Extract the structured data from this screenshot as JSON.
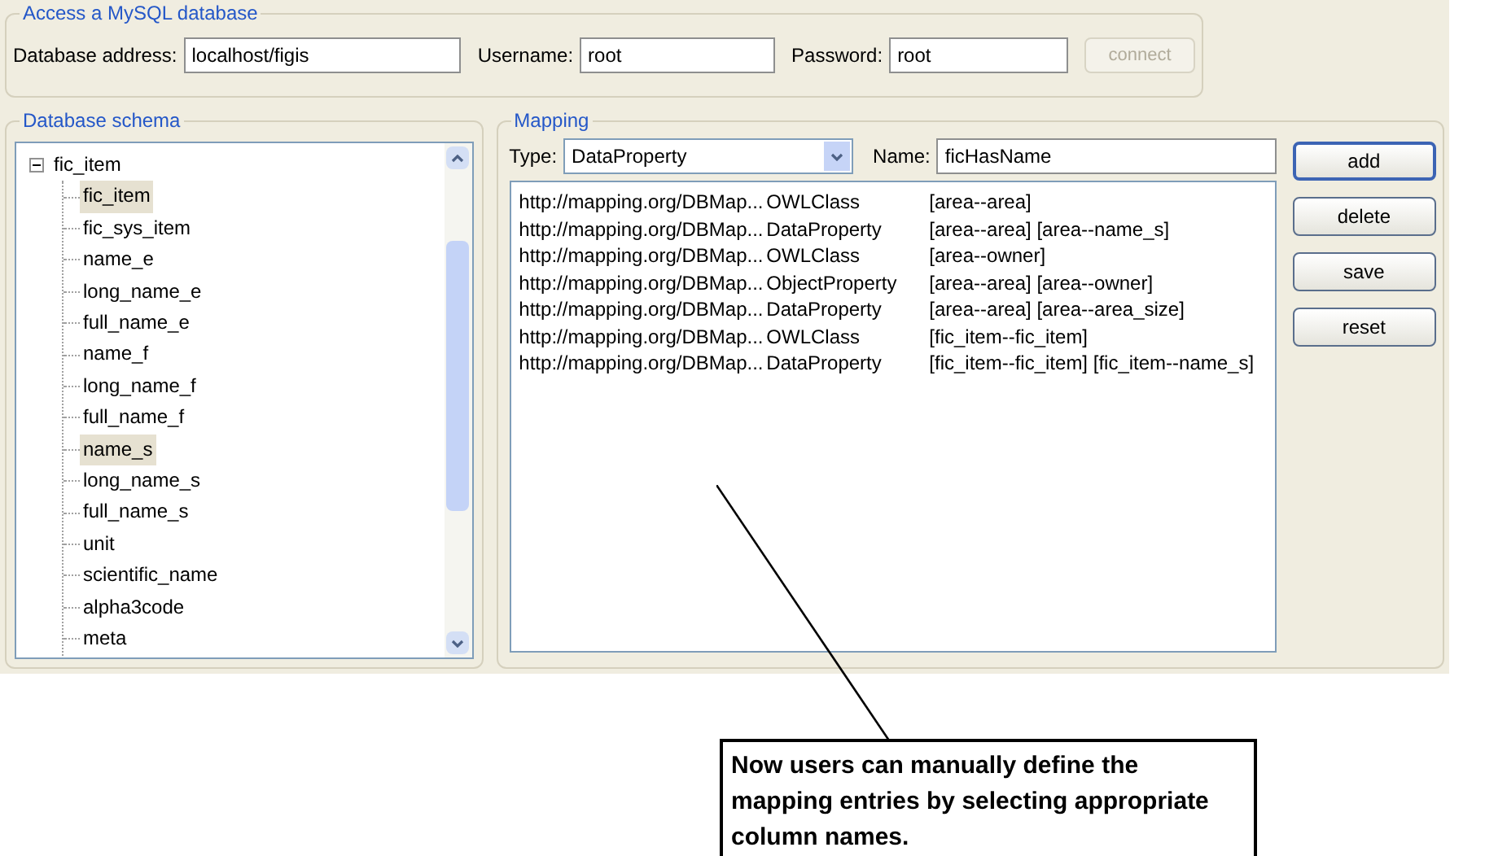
{
  "access": {
    "title": "Access a MySQL database",
    "address_label": "Database address:",
    "address": "localhost/figis",
    "username_label": "Username:",
    "username": "root",
    "password_label": "Password:",
    "password": "root",
    "connect": {
      "label": "connect",
      "disabled": true
    }
  },
  "schema": {
    "title": "Database schema",
    "tree": [
      {
        "label": "fic_item",
        "expanded": true,
        "selected": false,
        "children": [
          {
            "label": "fic_item",
            "selected": true
          },
          {
            "label": "fic_sys_item",
            "selected": false
          },
          {
            "label": "name_e",
            "selected": false
          },
          {
            "label": "long_name_e",
            "selected": false
          },
          {
            "label": "full_name_e",
            "selected": false
          },
          {
            "label": "name_f",
            "selected": false
          },
          {
            "label": "long_name_f",
            "selected": false
          },
          {
            "label": "full_name_f",
            "selected": false
          },
          {
            "label": "name_s",
            "selected": true
          },
          {
            "label": "long_name_s",
            "selected": false
          },
          {
            "label": "full_name_s",
            "selected": false
          },
          {
            "label": "unit",
            "selected": false
          },
          {
            "label": "scientific_name",
            "selected": false
          },
          {
            "label": "alpha3code",
            "selected": false
          },
          {
            "label": "meta",
            "selected": false
          }
        ]
      }
    ]
  },
  "mapping": {
    "title": "Mapping",
    "type_label": "Type:",
    "type": "DataProperty",
    "name_label": "Name:",
    "name": "ficHasName",
    "rows": [
      {
        "uri": "http://mapping.org/DBMap...",
        "kind": "OWLClass",
        "columns": "[area--area]"
      },
      {
        "uri": "http://mapping.org/DBMap...",
        "kind": "DataProperty",
        "columns": "[area--area] [area--name_s]"
      },
      {
        "uri": "http://mapping.org/DBMap...",
        "kind": "OWLClass",
        "columns": "[area--owner]"
      },
      {
        "uri": "http://mapping.org/DBMap...",
        "kind": "ObjectProperty",
        "columns": "[area--area] [area--owner]"
      },
      {
        "uri": "http://mapping.org/DBMap...",
        "kind": "DataProperty",
        "columns": "[area--area] [area--area_size]"
      },
      {
        "uri": "http://mapping.org/DBMap...",
        "kind": "OWLClass",
        "columns": "[fic_item--fic_item]"
      },
      {
        "uri": "http://mapping.org/DBMap...",
        "kind": "DataProperty",
        "columns": "[fic_item--fic_item] [fic_item--name_s]"
      }
    ],
    "buttons": [
      {
        "label": "add",
        "selected": true
      },
      {
        "label": "delete",
        "selected": false
      },
      {
        "label": "save",
        "selected": false
      },
      {
        "label": "reset",
        "selected": false
      }
    ]
  },
  "callout": "Now users can manually define the mapping entries by selecting appropriate column names."
}
